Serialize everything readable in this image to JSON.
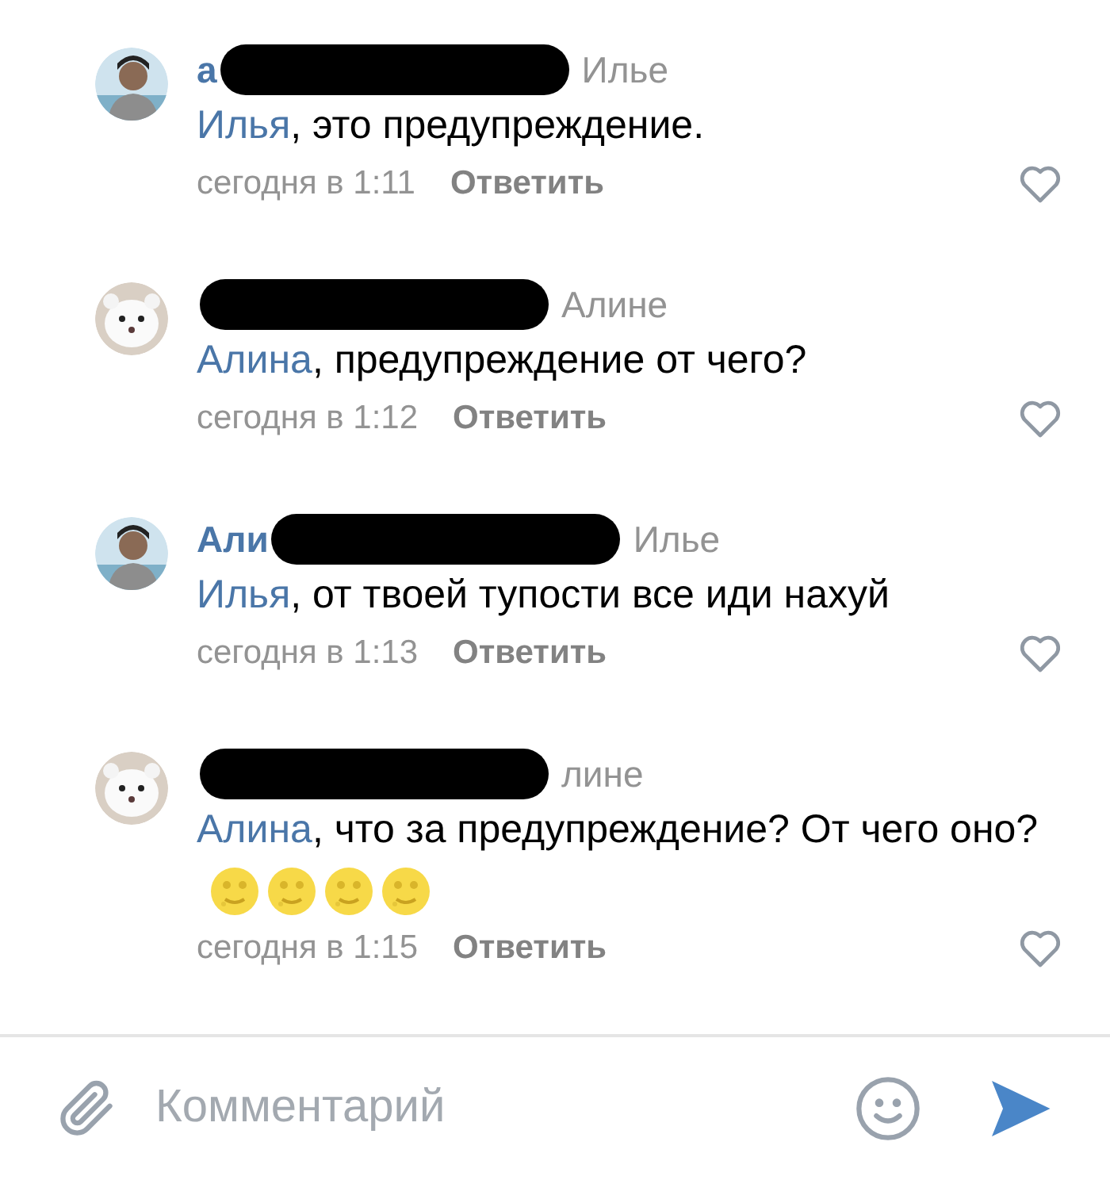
{
  "comments": [
    {
      "avatar": {
        "kind": "person"
      },
      "author_visible": "а",
      "reply_to": "Илье",
      "mention": "Илья",
      "text": ", это предупреждение.",
      "time": "сегодня в 1:11",
      "reply": "Ответить",
      "liked": false
    },
    {
      "avatar": {
        "kind": "animal"
      },
      "reply_to": "Алине",
      "mention": "Алина",
      "text": ", предупреждение от чего?",
      "time": "сегодня в 1:12",
      "reply": "Ответить",
      "liked": false
    },
    {
      "avatar": {
        "kind": "person"
      },
      "author_visible": "Али",
      "reply_to": "Илье",
      "mention": "Илья",
      "text": ", от твоей тупости все иди нахуй",
      "time": "сегодня в 1:13",
      "reply": "Ответить",
      "liked": false
    },
    {
      "avatar": {
        "kind": "animal"
      },
      "reply_to": "лине",
      "mention": "Алина",
      "text": ", что за предупреждение? От чего оно?",
      "emojis": [
        {
          "kind": "moon-face"
        },
        {
          "kind": "moon-face"
        },
        {
          "kind": "moon-face"
        },
        {
          "kind": "moon-face"
        }
      ],
      "time": "сегодня в 1:15",
      "reply": "Ответить",
      "liked": false
    }
  ],
  "composer": {
    "placeholder": "Комментарий"
  }
}
